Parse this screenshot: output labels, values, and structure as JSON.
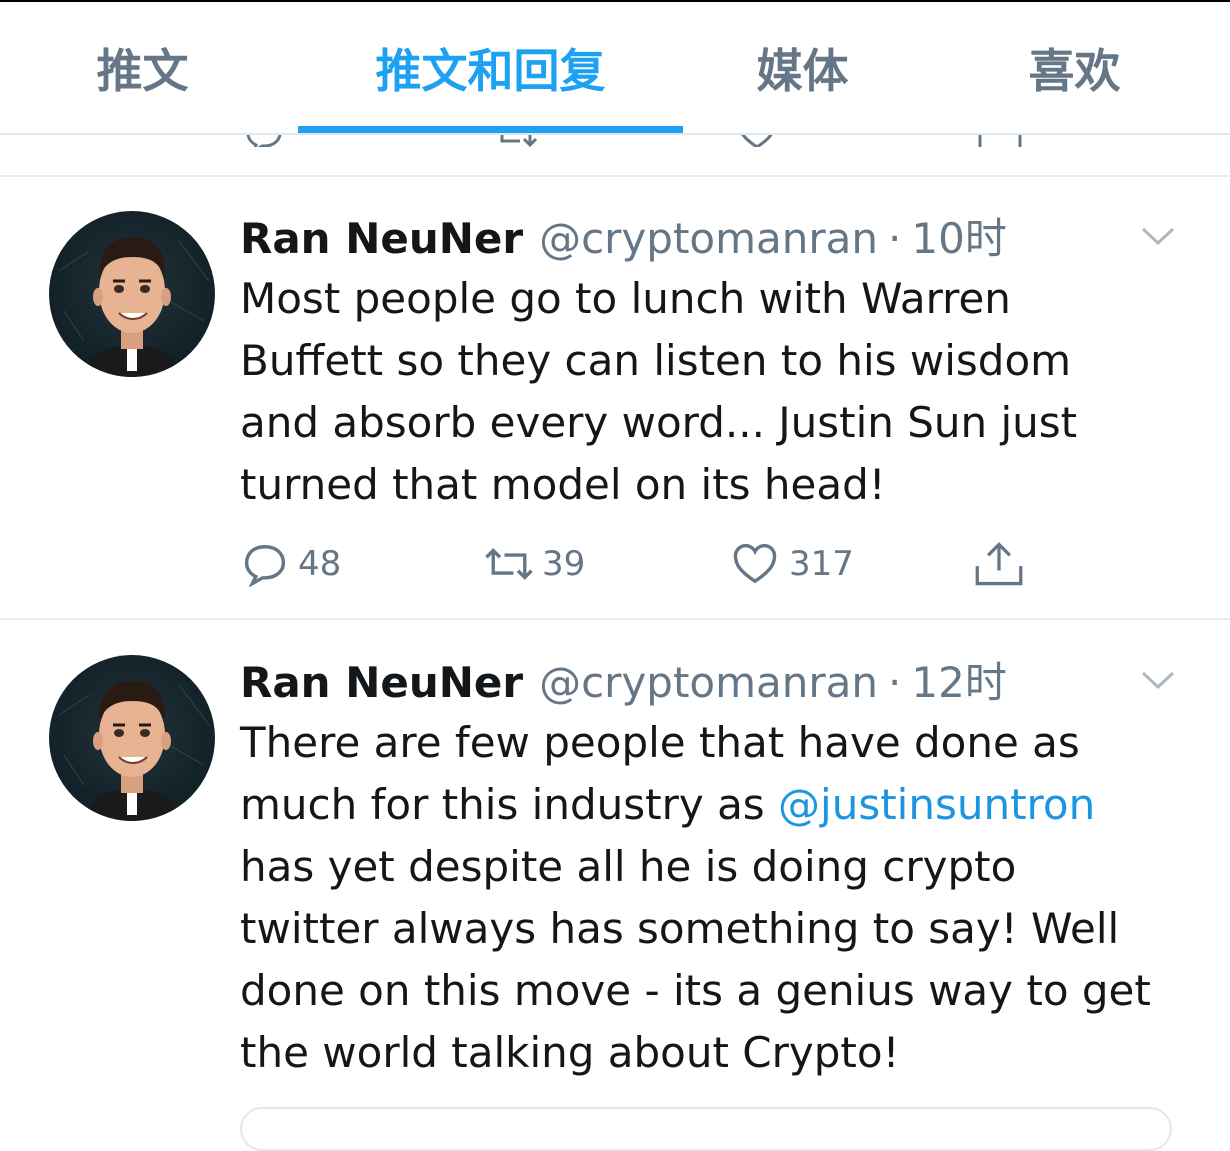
{
  "tabs": [
    {
      "label": "推文",
      "active": false
    },
    {
      "label": "推文和回复",
      "active": true
    },
    {
      "label": "媒体",
      "active": false
    },
    {
      "label": "喜欢",
      "active": false
    }
  ],
  "colors": {
    "accent": "#1da1f2",
    "mention": "#1b95e0",
    "muted": "#657786",
    "text": "#14171a",
    "divider": "#e6ecf0"
  },
  "tweets": [
    {
      "author": "Ran NeuNer",
      "handle": "@cryptomanran",
      "separator": "·",
      "time": "10时",
      "lines": [
        "Most people go to lunch with Warren",
        "Buffett so they can listen to his wisdom",
        "and absorb every word... Justin Sun just",
        "turned that model on its head!"
      ],
      "replies": "48",
      "retweets": "39",
      "likes": "317"
    },
    {
      "author": "Ran NeuNer",
      "handle": "@cryptomanran",
      "separator": "·",
      "time": "12时",
      "line1": "There are few people that have done as",
      "line2_text": "much for this industry as ",
      "line2_mention": "@justinsuntron",
      "line3": "has yet despite all he is doing crypto",
      "line4": "twitter always has something to say! Well",
      "line5": "done on this move - its a genius way to get",
      "line6": "the world talking about Crypto!"
    }
  ],
  "icons": {
    "reply": "reply-icon",
    "retweet": "retweet-icon",
    "like": "heart-icon",
    "share": "share-icon",
    "caret": "chevron-down-icon"
  }
}
